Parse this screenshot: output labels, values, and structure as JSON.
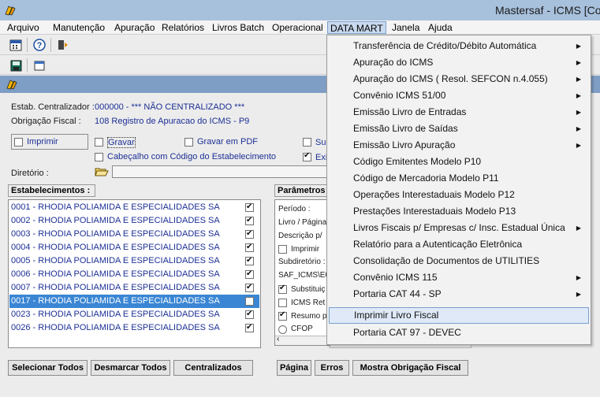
{
  "window": {
    "title": "Mastersaf - ICMS [Co"
  },
  "menubar": {
    "items": [
      "Arquivo",
      "Manutenção",
      "Apuração",
      "Relatórios",
      "Livros Batch",
      "Operacional",
      "DATA MART",
      "Janela",
      "Ajuda"
    ]
  },
  "form": {
    "estab_centralizador_label": "Estab. Centralizador :",
    "estab_centralizador_value": "000000  -  *** NÃO CENTRALIZADO ***",
    "obrigacao_label": "Obrigação Fiscal :",
    "obrigacao_value": "108   Registro de Apuracao do ICMS - P9",
    "imprimir_label": "Imprimir",
    "gravar_label": "Gravar",
    "gravar_pdf_label": "Gravar em PDF",
    "su_label": "Su",
    "cabecalho_label": "Cabeçalho com Código do Estabelecimento",
    "exi_label": "Exi",
    "diretorio_label": "Diretório :"
  },
  "estabelecimentos": {
    "header": "Estabelecimentos :",
    "rows": [
      {
        "label": "0001 - RHODIA POLIAMIDA E ESPECIALIDADES SA",
        "checked": true
      },
      {
        "label": "0002 - RHODIA POLIAMIDA E ESPECIALIDADES SA",
        "checked": true
      },
      {
        "label": "0003 - RHODIA POLIAMIDA E ESPECIALIDADES SA",
        "checked": true
      },
      {
        "label": "0004 - RHODIA POLIAMIDA E ESPECIALIDADES SA",
        "checked": true
      },
      {
        "label": "0005 - RHODIA POLIAMIDA E ESPECIALIDADES SA",
        "checked": true
      },
      {
        "label": "0006 - RHODIA POLIAMIDA E ESPECIALIDADES SA",
        "checked": true
      },
      {
        "label": "0007 - RHODIA POLIAMIDA E ESPECIALIDADES SA",
        "checked": true
      },
      {
        "label": "0017 - RHODIA POLIAMIDA E ESPECIALIDADES SA",
        "checked": false
      },
      {
        "label": "0023 - RHODIA POLIAMIDA E ESPECIALIDADES SA",
        "checked": true
      },
      {
        "label": "0026 - RHODIA POLIAMIDA E ESPECIALIDADES SA",
        "checked": true
      }
    ]
  },
  "parametros": {
    "header": "Parâmetros",
    "periodo": "Período :",
    "livro_pagina": "Livro / Página",
    "descricao": "Descrição p/",
    "imprimir": "Imprimir",
    "subdiretorio": "Subdiretório :",
    "path": "SAF_ICMS\\E0",
    "substituicao": "Substituiç",
    "icms_ret": "ICMS Ret",
    "resumo": "Resumo p",
    "cfop": "CFOP"
  },
  "buttons": {
    "selecionar_todos": "Selecionar Todos",
    "desmarcar_todos": "Desmarcar Todos",
    "centralizados": "Centralizados",
    "pagina": "Página",
    "erros": "Erros",
    "mostra_obrigacao": "Mostra Obrigação Fiscal"
  },
  "data_mart_menu": {
    "items": [
      {
        "label": "Transferência de Crédito/Débito Automática",
        "submenu": true
      },
      {
        "label": "Apuração do ICMS",
        "submenu": true
      },
      {
        "label": "Apuração do ICMS ( Resol. SEFCON n.4.055)",
        "submenu": true
      },
      {
        "label": "Convênio ICMS 51/00",
        "submenu": true
      },
      {
        "label": "Emissão Livro de Entradas",
        "submenu": true
      },
      {
        "label": "Emissão Livro de Saídas",
        "submenu": true
      },
      {
        "label": "Emissão Livro Apuração",
        "submenu": true
      },
      {
        "label": "Código Emitentes Modelo P10",
        "submenu": false
      },
      {
        "label": "Código de Mercadoria Modelo P11",
        "submenu": false
      },
      {
        "label": "Operações Interestaduais Modelo P12",
        "submenu": false
      },
      {
        "label": "Prestações Interestaduais Modelo P13",
        "submenu": false
      },
      {
        "label": "Livros Fiscais p/ Empresas c/ Insc. Estadual Única",
        "submenu": true
      },
      {
        "label": "Relatório para a Autenticação Eletrônica",
        "submenu": false
      },
      {
        "label": "Consolidação de Documentos de UTILITIES",
        "submenu": false
      },
      {
        "label": "Convênio ICMS 115",
        "submenu": true
      },
      {
        "label": "Portaria CAT 44 - SP",
        "submenu": true
      },
      {
        "label": "Imprimir Livro Fiscal",
        "submenu": false
      },
      {
        "label": "Portaria CAT 97 - DEVEC",
        "submenu": false
      }
    ]
  }
}
